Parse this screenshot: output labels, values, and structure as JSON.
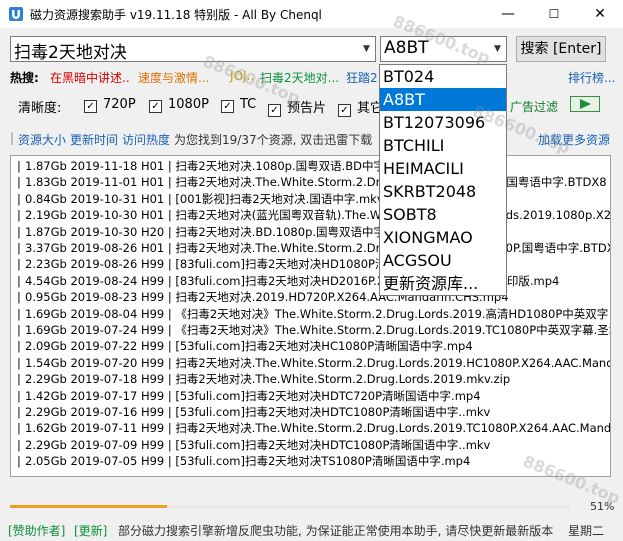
{
  "window": {
    "title": "磁力资源搜索助手 v19.11.18 特别版 - All By Chenql",
    "minimize": "—",
    "maximize": "☐",
    "close": "✕"
  },
  "search": {
    "query": "扫毒2天地对决",
    "site": "A8BT",
    "button": "搜索 [Enter]"
  },
  "hot": {
    "label": "热搜:",
    "items": [
      {
        "text": "在黑暗中讲述..",
        "color": "#d40000"
      },
      {
        "text": "速度与激情...",
        "color": "#e07000"
      },
      {
        "text": "JOJ..",
        "color": "#c8a000"
      },
      {
        "text": "扫毒2天地对...",
        "color": "#0a8f3a"
      },
      {
        "text": "狂踏2...",
        "color": "#1a5fb4"
      }
    ],
    "more": "排行榜..."
  },
  "clarity": {
    "label": "清晰度:",
    "options": [
      {
        "label": "720P",
        "checked": true
      },
      {
        "label": "1080P",
        "checked": true
      },
      {
        "label": "TC",
        "checked": true
      },
      {
        "label": "预告片",
        "checked": true
      },
      {
        "label": "其它",
        "checked": true
      }
    ],
    "ad_filter": "广告过滤"
  },
  "sort": {
    "size": "资源大小",
    "update": "更新时间",
    "hot": "访问热度",
    "info": "为您找到19/37个资源, 双击迅雷下载",
    "load_more": "加载更多资源"
  },
  "results": [
    "1.87Gb 2019-11-18 H01 | 扫毒2天地对决.1080p.国粤双语.BD中字",
    "1.83Gb 2019-11-01 H01 | 扫毒2天地对决.The.White.Storm.2.Drug.Lords.2019.1080p.国粤语中字.BTDX8",
    "0.84Gb 2019-10-31 H01 | [001影视]扫毒2天地对决.国语中字.mkv",
    "2.19Gb 2019-10-30 H01 | 扫毒2天地对决(蓝光国粤双音轨).The.White.Storm.2.Drug.Lords.2019.1080p.X264.AAC.2",
    "1.87Gb 2019-10-30 H20 | 扫毒2天地对决.BD.1080p.国粤双语中字",
    "3.37Gb 2019-08-26 H01 | 扫毒2天地对决.The.White.Storm.2.Drug.Lords.2019.HD1080P.国粤语中字.BTDX",
    "2.23Gb 2019-08-26 H99 | [83fuli.com]扫毒2天地对决HD1080P清晰国语中字.mp4",
    "4.54Gb 2019-08-24 H99 | [83fuli.com]扫毒2天地对决HD2016P.X264.AAC.国语中字无水印版.mp4",
    "0.95Gb 2019-08-23 H99 | 扫毒2天地对决.2019.HD720P.X264.AAC.Mandarin.CHS.mp4",
    "1.69Gb 2019-08-04 H99 | 《扫毒2天地对决》The.White.Storm.2.Drug.Lords.2019.高清HD1080P中英双字",
    "1.69Gb 2019-07-24 H99 | 《扫毒2天地对决》The.White.Storm.2.Drug.Lords.2019.TC1080P中英双字幕.圣城",
    "2.09Gb 2019-07-22 H99 | [53fuli.com]扫毒2天地对决HC1080P清晰国语中字.mp4",
    "1.54Gb 2019-07-20 H99 | 扫毒2天地对决.The.White.Storm.2.Drug.Lords.2019.HC1080P.X264.AAC.Mand",
    "2.29Gb 2019-07-18 H99 | 扫毒2天地对决.The.White.Storm.2.Drug.Lords.2019.mkv.zip",
    "1.42Gb 2019-07-17 H99 | [53fuli.com]扫毒2天地对决HDTC720P清晰国语中字.mp4",
    "2.29Gb 2019-07-16 H99 | [53fuli.com]扫毒2天地对决HDTC1080P清晰国语中字..mkv",
    "1.62Gb 2019-07-11 H99 | 扫毒2天地对决.The.White.Storm.2.Drug.Lords.2019.TC1080P.X264.AAC.Manda",
    "2.29Gb 2019-07-09 H99 | [53fuli.com]扫毒2天地对决HDTC1080P清晰国语中字..mkv",
    "2.05Gb 2019-07-05 H99 | [53fuli.com]扫毒2天地对决TS1080P清晰国语中字.mp4"
  ],
  "dropdown": {
    "options": [
      "BT024",
      "A8BT",
      "BT12073096",
      "BTCHILI",
      "HEIMACILI",
      "SKRBT2048",
      "SOBT8",
      "XIONGMAO",
      "ACGSOU",
      "更新资源库..."
    ],
    "selected": "A8BT"
  },
  "progress": {
    "percent": 51,
    "label": "51%"
  },
  "status": {
    "sponsor": "[赞助作者]",
    "update": "[更新]",
    "message": "部分磁力搜索引擎新增反爬虫功能, 为保证能正常使用本助手, 请尽快更新最新版本",
    "day": "星期二"
  },
  "watermark": "886600.top",
  "colors": {
    "selection": "#0078d7",
    "link": "#1a5fb4",
    "progress": "#f0a020"
  }
}
